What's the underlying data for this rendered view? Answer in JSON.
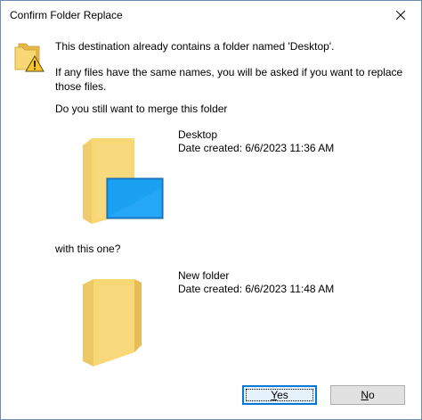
{
  "window": {
    "title": "Confirm Folder Replace"
  },
  "message": {
    "line1": "This destination already contains a folder named 'Desktop'.",
    "line2a": "If any files have the same names, you will be asked if you want to replace",
    "line2b": "those files.",
    "line3": "Do you still want to merge this folder"
  },
  "source_folder": {
    "name": "Desktop",
    "date_created": "Date created: 6/6/2023 11:36 AM",
    "icon": "desktop-folder-icon"
  },
  "between_text": "with this one?",
  "target_folder": {
    "name": "New folder",
    "date_created": "Date created: 6/6/2023 11:48 AM",
    "icon": "folder-icon"
  },
  "buttons": {
    "yes_first": "Y",
    "yes_rest": "es",
    "no_first": "N",
    "no_rest": "o"
  },
  "colors": {
    "accent": "#0078d7",
    "folder_yellow": "#f8d775",
    "warning_yellow": "#f5c52b"
  }
}
